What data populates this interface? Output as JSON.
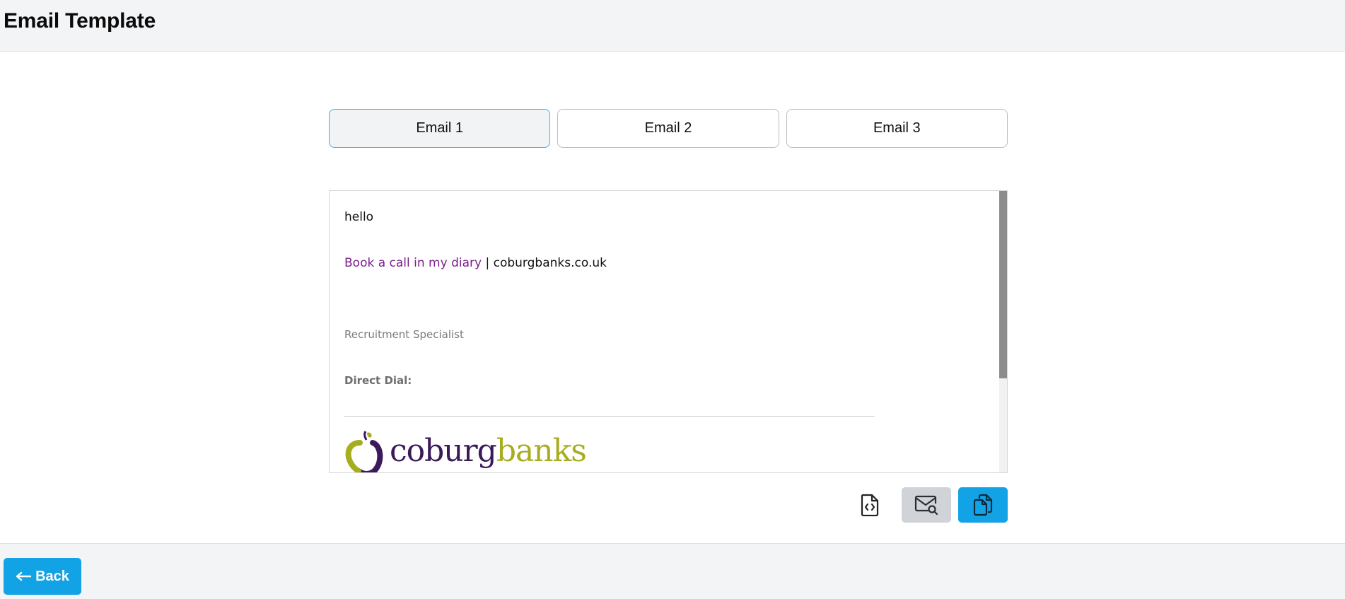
{
  "header": {
    "title": "Email Template"
  },
  "tabs": [
    {
      "label": "Email 1",
      "active": true
    },
    {
      "label": "Email 2",
      "active": false
    },
    {
      "label": "Email 3",
      "active": false
    }
  ],
  "preview": {
    "greeting": "hello",
    "book_link": "Book a call in my diary",
    "separator": " | ",
    "website": "coburgbanks.co.uk",
    "role": "Recruitment Specialist",
    "direct_dial_label": "Direct Dial:",
    "logo": {
      "part1": "coburg",
      "part2": "banks"
    }
  },
  "actions": {
    "source_icon": "file-code-icon",
    "preview_icon": "mail-search-icon",
    "copy_icon": "copy-icon"
  },
  "footer": {
    "back_label": "Back",
    "back_icon": "arrow-left-icon"
  },
  "colors": {
    "accent": "#12a3e6",
    "active_tab_border": "#35b3e8",
    "link_purple": "#7b1f8b",
    "logo_purple": "#3b1a5a",
    "logo_green": "#a7ad1e"
  }
}
